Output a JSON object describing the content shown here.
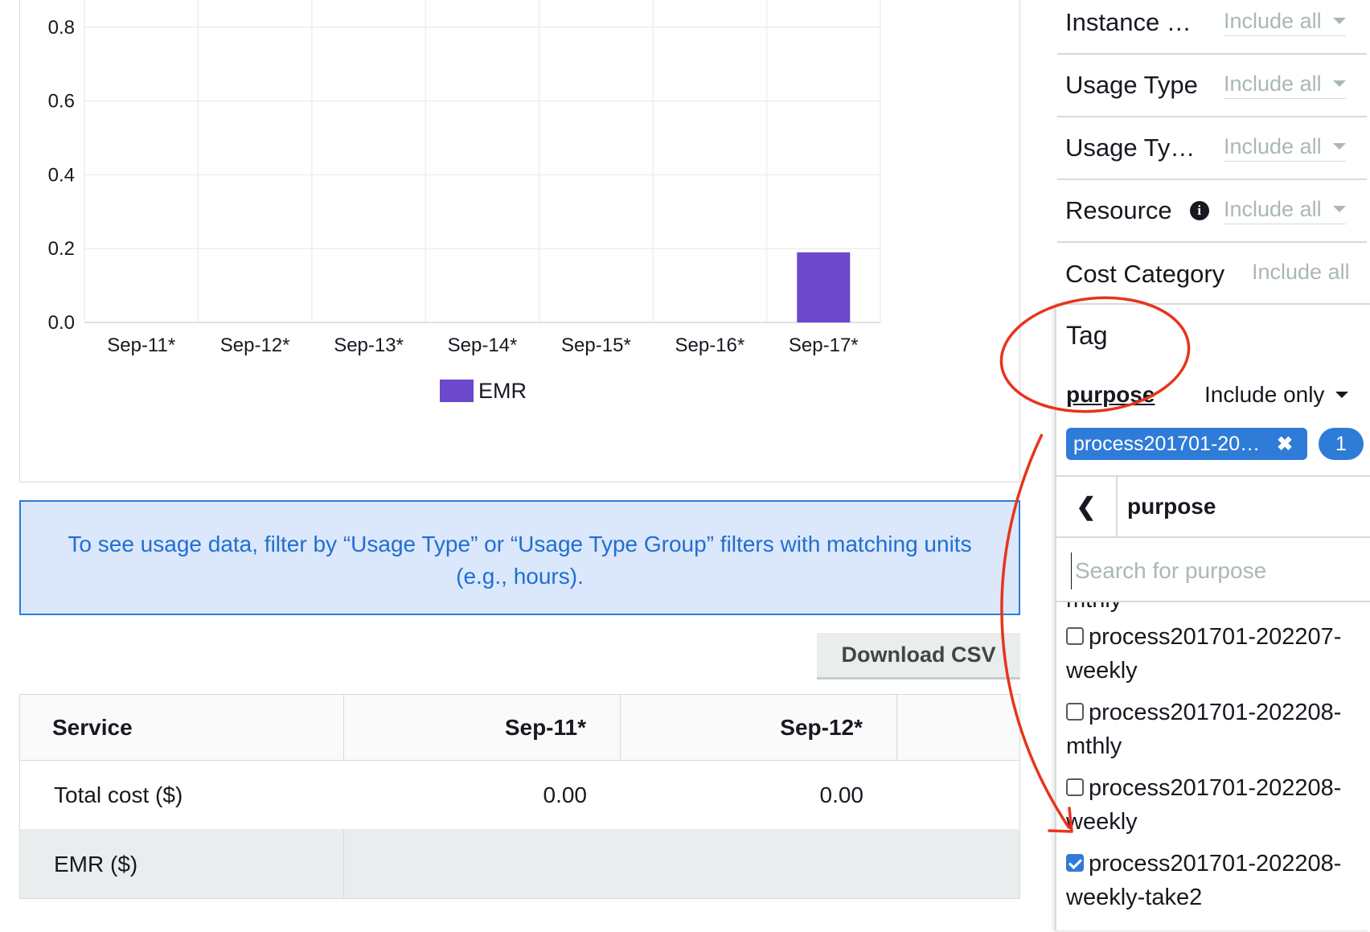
{
  "chart_data": {
    "type": "bar",
    "categories": [
      "Sep-11*",
      "Sep-12*",
      "Sep-13*",
      "Sep-14*",
      "Sep-15*",
      "Sep-16*",
      "Sep-17*"
    ],
    "series": [
      {
        "name": "EMR",
        "values": [
          0,
          0,
          0,
          0,
          0,
          0,
          0.19
        ],
        "color": "#6b48cc"
      }
    ],
    "yticks": [
      "0.0",
      "0.2",
      "0.4",
      "0.6",
      "0.8"
    ],
    "ylim": [
      0,
      0.87
    ],
    "grid": true,
    "legend": "bottom"
  },
  "info": {
    "line1": "To see usage data, filter by “Usage Type” or “Usage Type Group” filters with matching units",
    "line2": "(e.g., hours)."
  },
  "download_label": "Download CSV",
  "table": {
    "headers": [
      "Service",
      "Sep-11*",
      "Sep-12*"
    ],
    "rows": [
      {
        "label": "Total cost ($)",
        "values": [
          "0.00",
          "0.00"
        ]
      },
      {
        "label": "EMR ($)",
        "values": [
          "",
          ""
        ]
      }
    ]
  },
  "footer": "",
  "filters": [
    {
      "name": "Instance …",
      "value": "Include all",
      "has_caret": true
    },
    {
      "name": "Usage Type",
      "value": "Include all",
      "has_caret": true
    },
    {
      "name": "Usage Ty…",
      "value": "Include all",
      "has_caret": true
    },
    {
      "name": "Resource",
      "value": "Include all",
      "has_caret": true,
      "icon": "info-icon"
    },
    {
      "name": "Cost Category",
      "value": "Include all",
      "has_caret": false
    }
  ],
  "tag": {
    "title": "Tag",
    "key": "purpose",
    "mode": "Include only",
    "chip": "process201701-202…",
    "chip_remove": "✖",
    "count": "1",
    "back_glyph": "❮",
    "subheader": "purpose",
    "search_placeholder": "Search for purpose",
    "partial_option": "mthly",
    "options": [
      {
        "line1": "process201701-202207-",
        "line2": "weekly",
        "checked": false
      },
      {
        "line1": "process201701-202208-",
        "line2": "mthly",
        "checked": false
      },
      {
        "line1": "process201701-202208-",
        "line2": "weekly",
        "checked": false
      },
      {
        "line1": "process201701-202208-",
        "line2": "weekly-take2",
        "checked": true
      }
    ]
  },
  "annotation_color": "#e8341c"
}
